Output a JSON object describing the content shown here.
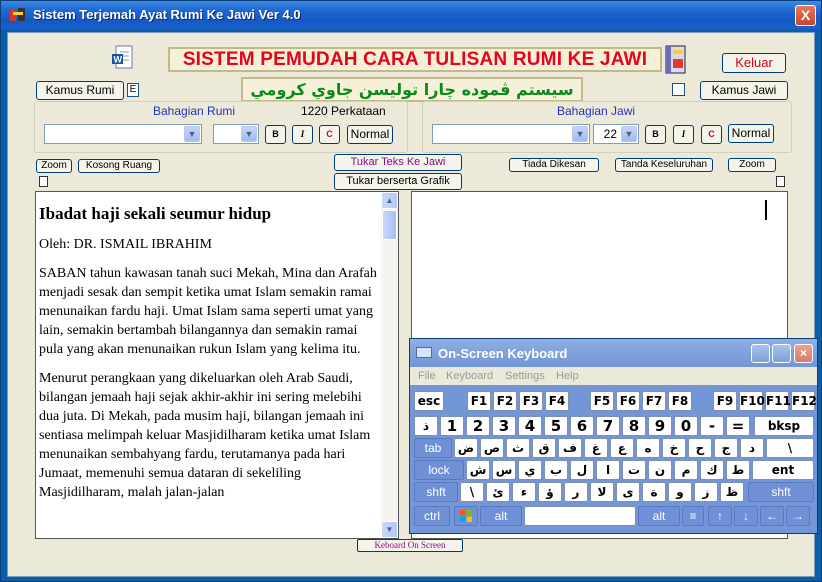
{
  "window": {
    "title": "Sistem Terjemah Ayat Rumi Ke Jawi  Ver 4.0",
    "close_label": "X"
  },
  "header": {
    "banner": "SISTEM PEMUDAH CARA TULISAN RUMI KE JAWI",
    "jawi_banner": "سيستم  ڤموده چارا توليسن جاوي كرومي",
    "keluar_label": "Keluar",
    "kamus_rumi_label": "Kamus Rumi",
    "kamus_rumi_check": "E",
    "kamus_jawi_label": "Kamus Jawi"
  },
  "rumi_group": {
    "title": "Bahagian Rumi",
    "count": "1220 Perkataan",
    "bold": "B",
    "italic": "I",
    "color": "C",
    "normal": "Normal"
  },
  "jawi_group": {
    "title": "Bahagian Jawi",
    "size": "22",
    "bold": "B",
    "italic": "I",
    "color": "C",
    "normal": "Normal"
  },
  "toolbar": {
    "zoom_left": "Zoom",
    "kosong": "Kosong Ruang",
    "tukar": "Tukar Teks Ke Jawi",
    "tukar_grafik": "Tukar berserta Grafik",
    "tiada": "Tiada Dikesan",
    "tanda": "Tanda Keseluruhan",
    "zoom_right": "Zoom"
  },
  "article": {
    "title": "Ibadat haji sekali seumur hidup",
    "byline": "Oleh: DR. ISMAIL IBRAHIM",
    "p1": "SABAN tahun kawasan tanah suci Mekah, Mina dan Arafah menjadi sesak dan sempit ketika umat Islam semakin ramai menunaikan fardu haji. Umat Islam sama seperti umat yang lain, semakin bertambah bilangannya dan semakin ramai pula yang akan menunaikan rukun Islam yang kelima itu.",
    "p2": "Menurut perangkaan yang dikeluarkan oleh Arab Saudi, bilangan jemaah haji sejak akhir-akhir ini sering melebihi dua juta. Di Mekah, pada musim haji, bilangan jemaah ini sentiasa melimpah keluar Masjidilharam ketika umat Islam menunaikan sembahyang fardu, terutamanya pada hari Jumaat, memenuhi semua dataran di sekeliling Masjidilharam, malah jalan-jalan"
  },
  "osk_launch": "Keboard  On Screen",
  "osk": {
    "title": "On-Screen Keyboard",
    "menus": [
      "File",
      "Keyboard",
      "Settings",
      "Help"
    ],
    "row1": [
      "esc",
      "F1",
      "F2",
      "F3",
      "F4",
      "F5",
      "F6",
      "F7",
      "F8",
      "F9",
      "F10",
      "F11",
      "F12"
    ],
    "row2": [
      "ذ",
      "1",
      "2",
      "3",
      "4",
      "5",
      "6",
      "7",
      "8",
      "9",
      "0",
      "-",
      "=",
      "bksp"
    ],
    "row3": [
      "tab",
      "ض",
      "ص",
      "ث",
      "ق",
      "ف",
      "غ",
      "ع",
      "ه",
      "خ",
      "ح",
      "ج",
      "د",
      "\\"
    ],
    "row4": [
      "lock",
      "ش",
      "س",
      "ي",
      "ب",
      "ل",
      "ا",
      "ت",
      "ن",
      "م",
      "ك",
      "ط",
      "ent"
    ],
    "row5": [
      "shft",
      "\\",
      "ئ",
      "ء",
      "ؤ",
      "ر",
      "لا",
      "ى",
      "ة",
      "و",
      "ز",
      "ظ",
      "shft"
    ],
    "row6": [
      "ctrl",
      "alt",
      "alt",
      "↑",
      "↓",
      "←",
      "→"
    ]
  }
}
